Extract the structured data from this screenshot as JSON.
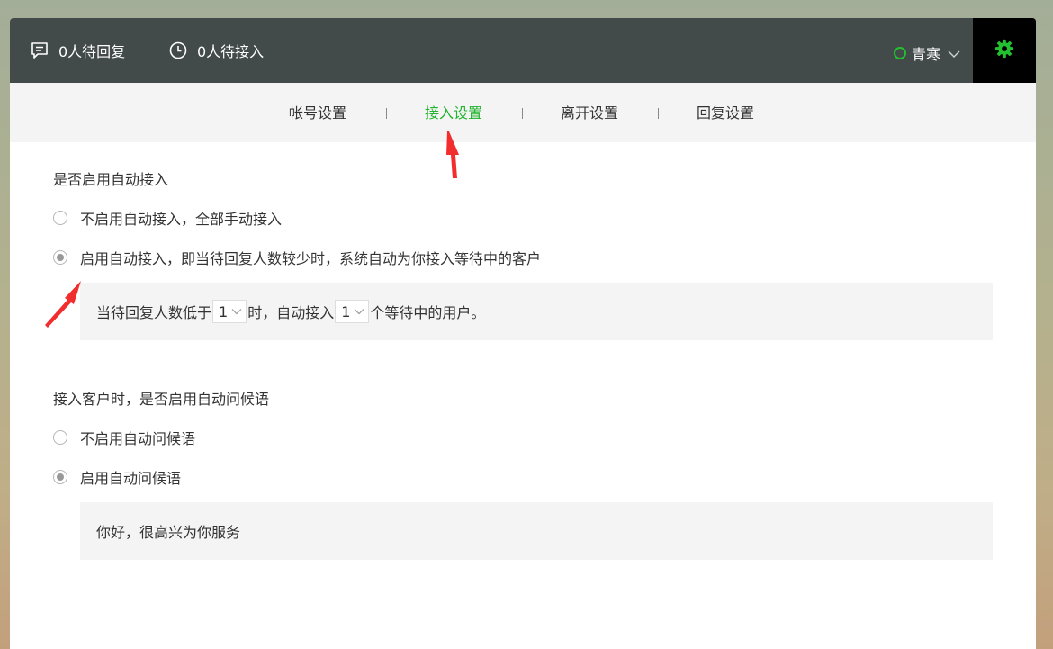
{
  "topbar": {
    "pending_reply": "0人待回复",
    "pending_accept": "0人待接入",
    "username": "青寒",
    "status_color": "#22c02e",
    "icons": [
      "chat-icon",
      "clock-icon",
      "status-dot-icon",
      "chevron-down-icon",
      "gear-icon"
    ]
  },
  "tabs": [
    {
      "label": "帐号设置",
      "active": false
    },
    {
      "label": "接入设置",
      "active": true
    },
    {
      "label": "离开设置",
      "active": false
    },
    {
      "label": "回复设置",
      "active": false
    }
  ],
  "auto_accept": {
    "title": "是否启用自动接入",
    "options": [
      {
        "label": "不启用自动接入，全部手动接入",
        "checked": false
      },
      {
        "label": "启用自动接入，即当待回复人数较少时，系统自动为你接入等待中的客户",
        "checked": true
      }
    ],
    "config": {
      "prefix": "当待回复人数低于",
      "threshold": "1",
      "middle": "时，自动接入",
      "count": "1",
      "suffix": "个等待中的用户。"
    }
  },
  "greeting": {
    "title": "接入客户时，是否启用自动问候语",
    "options": [
      {
        "label": "不启用自动问候语",
        "checked": false
      },
      {
        "label": "启用自动问候语",
        "checked": true
      }
    ],
    "message": "你好，很高兴为你服务"
  },
  "colors": {
    "accent": "#23b32e",
    "topbar_bg": "#434a4a",
    "annotation_arrow": "#f22d2d"
  }
}
